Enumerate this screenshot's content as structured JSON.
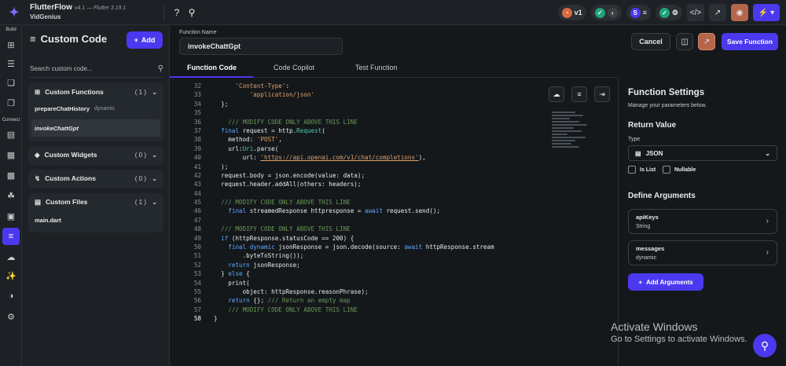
{
  "app": {
    "name": "FlutterFlow",
    "version": "v4.1 — Flutter 3.19.1",
    "team": "VidGenius"
  },
  "topbar": {
    "help_icon": "?",
    "search_icon": "⚲",
    "version_badge": "v1",
    "user_badge": "S",
    "colors": {
      "accent": "#4b39ef",
      "teal": "#1fa37a",
      "orange": "#d96b3f"
    }
  },
  "rail": {
    "build_label": "Build",
    "connect_label": "Connect"
  },
  "panel": {
    "title": "Custom Code",
    "add_label": "Add",
    "search_placeholder": "Search custom code...",
    "groups": [
      {
        "label": "Custom Functions",
        "count": "( 1 )",
        "items": [
          {
            "name": "prepareChatHistory",
            "tag": "dynamic"
          },
          {
            "name": "invokeChattGpt",
            "tag": ""
          }
        ]
      },
      {
        "label": "Custom Widgets",
        "count": "( 0 )"
      },
      {
        "label": "Custom Actions",
        "count": "( 0 )"
      },
      {
        "label": "Custom Files",
        "count": "( 1 )",
        "items": [
          {
            "name": "main.dart",
            "tag": ""
          }
        ]
      }
    ]
  },
  "header": {
    "function_name_label": "Function Name",
    "function_name": "invokeChattGpt",
    "cancel_label": "Cancel",
    "save_label": "Save Function"
  },
  "tabs": [
    "Function Code",
    "Code Copilot",
    "Test Function"
  ],
  "code": {
    "lines": [
      {
        "n": "32",
        "t": "      'Content-Type':"
      },
      {
        "n": "33",
        "t": "          'application/json'"
      },
      {
        "n": "34",
        "t": "  };"
      },
      {
        "n": "35",
        "t": ""
      },
      {
        "n": "36",
        "t": "    /// MODIFY CODE ONLY ABOVE THIS LINE"
      },
      {
        "n": "37",
        "t": "  final request = http.Request("
      },
      {
        "n": "38",
        "t": "    method: 'POST',"
      },
      {
        "n": "39",
        "t": "    url:Uri.parse("
      },
      {
        "n": "40",
        "t": "        url: 'https://api.openai.com/v1/chat/completions'),"
      },
      {
        "n": "41",
        "t": "  );"
      },
      {
        "n": "42",
        "t": "  request.body = json.encode(value: data);"
      },
      {
        "n": "43",
        "t": "  request.header.addAll(others: headers);"
      },
      {
        "n": "44",
        "t": ""
      },
      {
        "n": "45",
        "t": "  /// MODIFY CODE ONLY ABOVE THIS LINE"
      },
      {
        "n": "46",
        "t": "    final streamedResponse httpresponse = await request.send();"
      },
      {
        "n": "47",
        "t": ""
      },
      {
        "n": "48",
        "t": "  /// MODIFY CODE ONLY ABOVE THIS LINE"
      },
      {
        "n": "49",
        "t": "  if (httpResponse.statusCode == 200) {"
      },
      {
        "n": "50",
        "t": "    final dynamic jsonResponse = json.decode(source: await httpResponse.stream"
      },
      {
        "n": "51",
        "t": "        .byteToString());"
      },
      {
        "n": "52",
        "t": "    return jsonResponse;"
      },
      {
        "n": "53",
        "t": "  } else {"
      },
      {
        "n": "54",
        "t": "    print("
      },
      {
        "n": "55",
        "t": "        object: httpResponse.reasonPhrase);"
      },
      {
        "n": "56",
        "t": "    return {}; /// Return an empty map"
      },
      {
        "n": "57",
        "t": "    /// MODIFY CODE ONLY ABOVE THIS LINE"
      },
      {
        "n": "58",
        "t": "}"
      }
    ]
  },
  "settings": {
    "title": "Function Settings",
    "subtitle": "Manage your parameters below.",
    "return_value_label": "Return Value",
    "type_label": "Type",
    "type_value": "JSON",
    "is_list_label": "Is List",
    "nullable_label": "Nullable",
    "define_arguments_label": "Define Arguments",
    "arguments": [
      {
        "name": "apiKeys",
        "type": "String"
      },
      {
        "name": "messages",
        "type": "dynamic"
      }
    ],
    "add_arguments_label": "Add Arguments"
  },
  "watermark": {
    "line1": "Activate Windows",
    "line2": "Go to Settings to activate Windows."
  }
}
